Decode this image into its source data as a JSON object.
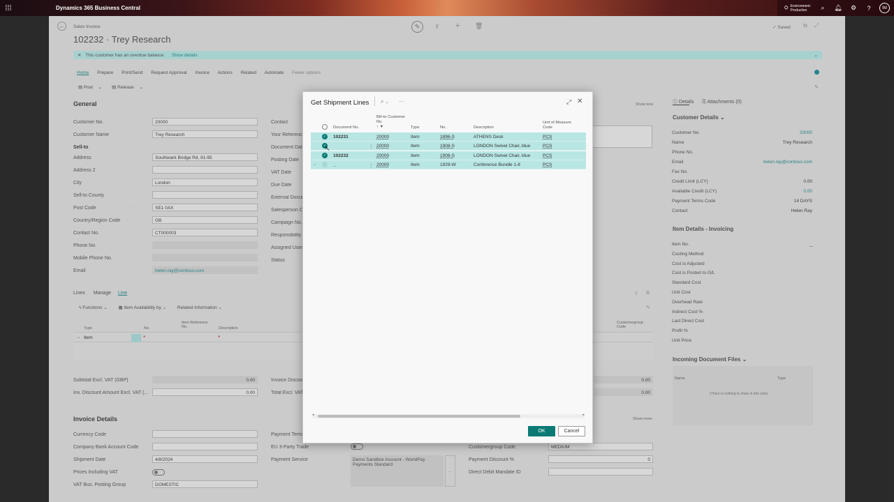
{
  "topbar": {
    "app_name": "Dynamics 365 Business Central",
    "env_label": "Environment:",
    "env_value": "Production",
    "avatar": "IM"
  },
  "page": {
    "breadcrumb": "Sales Invoice",
    "title": "102232 · Trey Research",
    "saved": "Saved",
    "banner_text": "This customer has an overdue balance.",
    "banner_link": "Show details",
    "menu": [
      "Home",
      "Prepare",
      "Print/Send",
      "Request Approval",
      "Invoice",
      "Actions",
      "Related",
      "Automate",
      "Fewer options"
    ],
    "actions": [
      "Post",
      "Release"
    ],
    "general_title": "General",
    "show_less": "Show less",
    "general_fields": [
      {
        "label": "Customer No.",
        "value": "20000"
      },
      {
        "label": "Customer Name",
        "value": "Trey Research"
      },
      {
        "label": "Sell-to",
        "value": ""
      },
      {
        "label": "Address",
        "value": "Southwark Bridge Rd, 91-95"
      },
      {
        "label": "Address 2",
        "value": ""
      },
      {
        "label": "City",
        "value": "London"
      },
      {
        "label": "Sell-to County",
        "value": ""
      },
      {
        "label": "Post Code",
        "value": "SE1 0AX"
      },
      {
        "label": "Country/Region Code",
        "value": "GB"
      },
      {
        "label": "Contact No.",
        "value": "CT000003"
      },
      {
        "label": "Phone No.",
        "value": ""
      },
      {
        "label": "Mobile Phone No.",
        "value": ""
      },
      {
        "label": "Email",
        "value": "helen.ray@contoso.com"
      }
    ],
    "general_fields_col2": [
      "Contact",
      "Your Reference",
      "Document Date",
      "Posting Date",
      "VAT Date",
      "Due Date",
      "External Document",
      "Salesperson Code",
      "Campaign No.",
      "Responsibility Center",
      "Assigned User ID",
      "Status"
    ],
    "lines_tabs": [
      "Lines",
      "Manage",
      "Line"
    ],
    "lines_actions": [
      "Functions",
      "Item Availability by",
      "Related Information"
    ],
    "lines_headers": [
      "Type",
      "No.",
      "Item Reference No.",
      "Description"
    ],
    "lines_right_headers": [
      "Customergroup Code"
    ],
    "line_type": "Item",
    "totals": [
      {
        "label": "Subtotal Excl. VAT (GBP)",
        "value": "0.00"
      },
      {
        "label": "Inv. Discount Amount Excl. VAT (...",
        "value": "0.00"
      }
    ],
    "totals_col2": [
      "Invoice Discount",
      "Total Excl. VAT"
    ],
    "totals_right": [
      "0.00",
      "0.00"
    ],
    "invoice_details_title": "Invoice Details",
    "show_more": "Show more",
    "invoice_fields": [
      {
        "label": "Currency Code",
        "value": ""
      },
      {
        "label": "Company Bank Account Code",
        "value": ""
      },
      {
        "label": "Shipment Date",
        "value": "4/8/2024"
      },
      {
        "label": "Prices Including VAT",
        "value": ""
      },
      {
        "label": "VAT Bus. Posting Group",
        "value": "DOMESTIC"
      }
    ],
    "invoice_fields_col2": [
      "Payment Terms",
      "EU 3-Party Trade",
      "Payment Service"
    ],
    "payment_service_value": "Demo Sandbox Account - WorldPay Payments Standard",
    "invoice_fields_col3": [
      {
        "label": "Customergroup Code",
        "value": "MEDIUM"
      },
      {
        "label": "Payment Discount %",
        "value": "0"
      },
      {
        "label": "Direct Debit Mandate ID",
        "value": ""
      }
    ]
  },
  "factbox": {
    "tabs": [
      "Details",
      "Attachments (0)"
    ],
    "customer_title": "Customer Details",
    "customer_rows": [
      {
        "label": "Customer No.",
        "value": "20000",
        "link": true
      },
      {
        "label": "Name",
        "value": "Trey Research",
        "link": false
      },
      {
        "label": "Phone No.",
        "value": "",
        "link": false
      },
      {
        "label": "Email",
        "value": "helen.ray@contoso.com",
        "link": true
      },
      {
        "label": "Fax No.",
        "value": "",
        "link": false
      },
      {
        "label": "Credit Limit (LCY)",
        "value": "0.00",
        "link": false
      },
      {
        "label": "Available Credit (LCY)",
        "value": "0.00",
        "link": true
      },
      {
        "label": "Payment Terms Code",
        "value": "14 DAYS",
        "link": false
      },
      {
        "label": "Contact",
        "value": "Helen Ray",
        "link": false
      }
    ],
    "item_title": "Item Details - Invoicing",
    "item_rows": [
      {
        "label": "Item No.",
        "value": "_"
      },
      {
        "label": "Costing Method",
        "value": ""
      },
      {
        "label": "Cost is Adjusted",
        "value": ""
      },
      {
        "label": "Cost is Posted to G/L",
        "value": ""
      },
      {
        "label": "Standard Cost",
        "value": ""
      },
      {
        "label": "Unit Cost",
        "value": ""
      },
      {
        "label": "Overhead Rate",
        "value": ""
      },
      {
        "label": "Indirect Cost %",
        "value": ""
      },
      {
        "label": "Last Direct Cost",
        "value": ""
      },
      {
        "label": "Profit %",
        "value": ""
      },
      {
        "label": "Unit Price",
        "value": ""
      }
    ],
    "incoming_title": "Incoming Document Files",
    "incoming_headers": [
      "Name",
      "Type"
    ],
    "incoming_empty": "(There is nothing to show in this view)"
  },
  "dialog": {
    "title": "Get Shipment Lines",
    "headers": {
      "document_no": "Document No.",
      "bill_to": "Bill-to Customer No.",
      "type": "Type",
      "no": "No.",
      "description": "Description",
      "uom": "Unit of Measure Code"
    },
    "rows": [
      {
        "doc": "102231",
        "bill_to": "20000",
        "type": "Item",
        "no": "1896-S",
        "desc": "ATHENS Desk",
        "uom": "PCS"
      },
      {
        "doc": "",
        "bill_to": "20000",
        "type": "Item",
        "no": "1908-S",
        "desc": "LONDON Swivel Chair, blue",
        "uom": "PCS"
      },
      {
        "doc": "102232",
        "bill_to": "20000",
        "type": "Item",
        "no": "1908-S",
        "desc": "LONDON Swivel Chair, blue",
        "uom": "PCS"
      },
      {
        "doc": "_",
        "bill_to": "20000",
        "type": "Item",
        "no": "1929-W",
        "desc": "Conference Bundle 1-8",
        "uom": "PCS"
      }
    ],
    "ok": "OK",
    "cancel": "Cancel"
  }
}
